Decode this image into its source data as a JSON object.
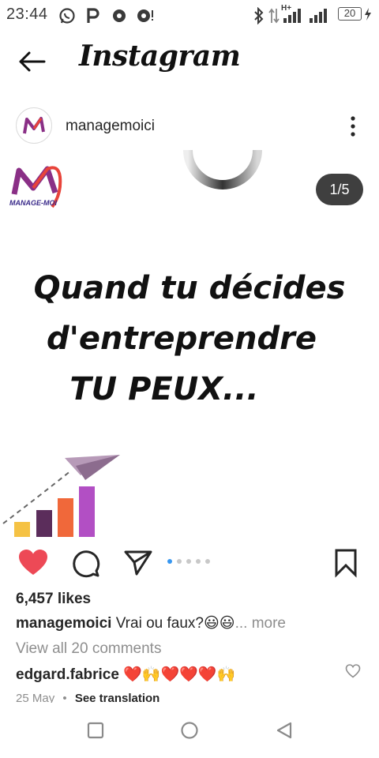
{
  "status_bar": {
    "time": "23:44",
    "network": "H+",
    "battery": "20"
  },
  "header": {
    "title": "Instagram"
  },
  "post": {
    "username": "managemoici",
    "carousel_counter": "1/5",
    "carousel_pages": 5,
    "carousel_current": 1,
    "brand_logo_text": "MANAGE-MOI",
    "headline": {
      "line1": "Quand tu décides",
      "line2": "d'entreprendre",
      "line3": "TU PEUX..."
    },
    "likes": "6,457 likes",
    "caption": {
      "username": "managemoici",
      "text": "Vrai ou faux?😃😃",
      "more": "... more"
    },
    "view_comments": "View all 20 comments",
    "comment": {
      "username": "edgard.fabrice",
      "text": "❤️🙌❤️❤️❤️🙌"
    },
    "meta": {
      "date": "25 May",
      "separator": "•",
      "translate": "See translation"
    }
  },
  "colors": {
    "like_red": "#ed4956",
    "accent_blue": "#3897f0",
    "muted_text": "#8e8e8e",
    "brand_purple": "#8a2f86"
  },
  "icons": {
    "back": "arrow-left-icon",
    "more": "more-vertical-icon",
    "like": "heart-filled-icon",
    "comment": "comment-bubble-icon",
    "share": "paper-plane-icon",
    "save": "bookmark-icon",
    "comment_like": "heart-outline-icon",
    "nav_recents": "square-icon",
    "nav_home": "circle-icon",
    "nav_back": "triangle-back-icon"
  }
}
